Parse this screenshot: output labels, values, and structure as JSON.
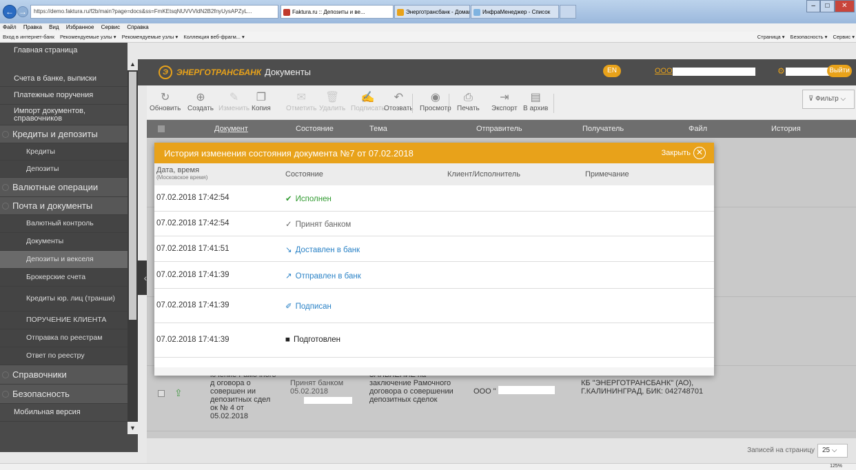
{
  "browser": {
    "address": "https://demo.faktura.ru/f2b/main?page=docs&ss=FmKEtsqNUVVVldN2B2fnyUysAPZyL...",
    "tabs": [
      "Faktura.ru :: Депозиты и ве...",
      "Энерготрансбанк - Домашняя",
      "ИнфраМенеджер - Список"
    ],
    "menu": [
      "Файл",
      "Правка",
      "Вид",
      "Избранное",
      "Сервис",
      "Справка"
    ],
    "favorites": [
      "Вход в интернет-банк",
      "Рекомендуемые узлы ▾",
      "Рекомендуемые узлы ▾",
      "Коллекция веб-фрагм... ▾"
    ],
    "tools": [
      "Страница ▾",
      "Безопасность ▾",
      "Сервис ▾"
    ],
    "zoom": "125%"
  },
  "sidebar": {
    "home": "Главная страница",
    "items": [
      {
        "label": "Счета в банке, выписки",
        "kind": "item"
      },
      {
        "label": "Платежные поручения",
        "kind": "item"
      },
      {
        "label": "Импорт документов, справочников",
        "kind": "item"
      },
      {
        "label": "Кредиты и депозиты",
        "kind": "sec"
      },
      {
        "label": "Кредиты",
        "kind": "sub"
      },
      {
        "label": "Депозиты",
        "kind": "sub"
      },
      {
        "label": "Валютные операции",
        "kind": "sec"
      },
      {
        "label": "Почта и документы",
        "kind": "sec"
      },
      {
        "label": "Валютный контроль",
        "kind": "sub"
      },
      {
        "label": "Документы",
        "kind": "sub"
      },
      {
        "label": "Депозиты и векселя",
        "kind": "sub"
      },
      {
        "label": "Брокерские счета",
        "kind": "sub"
      },
      {
        "label": "Кредиты юр. лиц (транши)",
        "kind": "sub"
      },
      {
        "label": "ПОРУЧЕНИЕ КЛИЕНТА",
        "kind": "sub"
      },
      {
        "label": "Отправка по реестрам",
        "kind": "sub"
      },
      {
        "label": "Ответ по реестру",
        "kind": "sub"
      },
      {
        "label": "Справочники",
        "kind": "sec"
      },
      {
        "label": "Безопасность",
        "kind": "sec"
      },
      {
        "label": "Мобильная версия",
        "kind": "item"
      }
    ]
  },
  "header": {
    "brand": "ЭНЕРГОТРАНСБАНК",
    "title": "Документы",
    "lang": "EN",
    "org": "ООО",
    "logout": "Выйти"
  },
  "toolbar": {
    "buttons": [
      {
        "label": "Обновить",
        "icon": "↻",
        "enabled": true
      },
      {
        "label": "Создать",
        "icon": "⊕",
        "enabled": true
      },
      {
        "label": "Изменить",
        "icon": "✎",
        "enabled": false
      },
      {
        "label": "Копия",
        "icon": "❐",
        "enabled": true
      },
      {
        "label": "Отметить",
        "icon": "✉",
        "enabled": false
      },
      {
        "label": "Удалить",
        "icon": "🗑",
        "enabled": false
      },
      {
        "label": "Подписать",
        "icon": "✍",
        "enabled": false
      },
      {
        "label": "Отозвать",
        "icon": "↶",
        "enabled": true
      },
      {
        "label": "Просмотр",
        "icon": "◉",
        "enabled": true
      },
      {
        "label": "Печать",
        "icon": "⎙",
        "enabled": true
      },
      {
        "label": "Экспорт",
        "icon": "⇥",
        "enabled": true
      },
      {
        "label": "В архив",
        "icon": "▤",
        "enabled": true
      }
    ],
    "filter": "Фильтр"
  },
  "table": {
    "columns": [
      "Документ",
      "Состояние",
      "Тема",
      "Отправитель",
      "Получатель",
      "Файл",
      "История"
    ],
    "row": {
      "document": "ючение Рамочного д оговора о совершен ии депозитных сдел ок № 4 от 05.02.2018",
      "status": "Принят банком 05.02.2018",
      "topic": "ЗАЯВЛЕНИЕ на заключение Рамочного договора о совершении депозитных сделок",
      "sender": "ООО \"",
      "recipient": "КБ \"ЭНЕРГОТРАНСБАНК\" (АО), Г.КАЛИНИНГРАД, БИК: 042748701"
    }
  },
  "pager": {
    "label": "Записей на страницу",
    "value": "25"
  },
  "modal": {
    "title": "История изменения состояния документа №7 от 07.02.2018",
    "close": "Закрыть",
    "columns": {
      "datetime": "Дата, время",
      "datetime_note": "(Московское время)",
      "state": "Состояние",
      "client": "Клиент/Исполнитель",
      "note": "Примечание"
    },
    "rows": [
      {
        "datetime": "07.02.2018 17:42:54",
        "state": "Исполнен",
        "icon": "✔",
        "tone": "ok"
      },
      {
        "datetime": "07.02.2018 17:42:54",
        "state": "Принят банком",
        "icon": "✓",
        "tone": "grey"
      },
      {
        "datetime": "07.02.2018 17:41:51",
        "state": "Доставлен в банк",
        "icon": "↘",
        "tone": "blue"
      },
      {
        "datetime": "07.02.2018 17:41:39",
        "state": "Отправлен в банк",
        "icon": "↗",
        "tone": "blue"
      },
      {
        "datetime": "07.02.2018 17:41:39",
        "state": "Подписан",
        "icon": "✐",
        "tone": "blue"
      },
      {
        "datetime": "07.02.2018 17:41:39",
        "state": "Подготовлен",
        "icon": "■",
        "tone": "dark"
      }
    ]
  }
}
